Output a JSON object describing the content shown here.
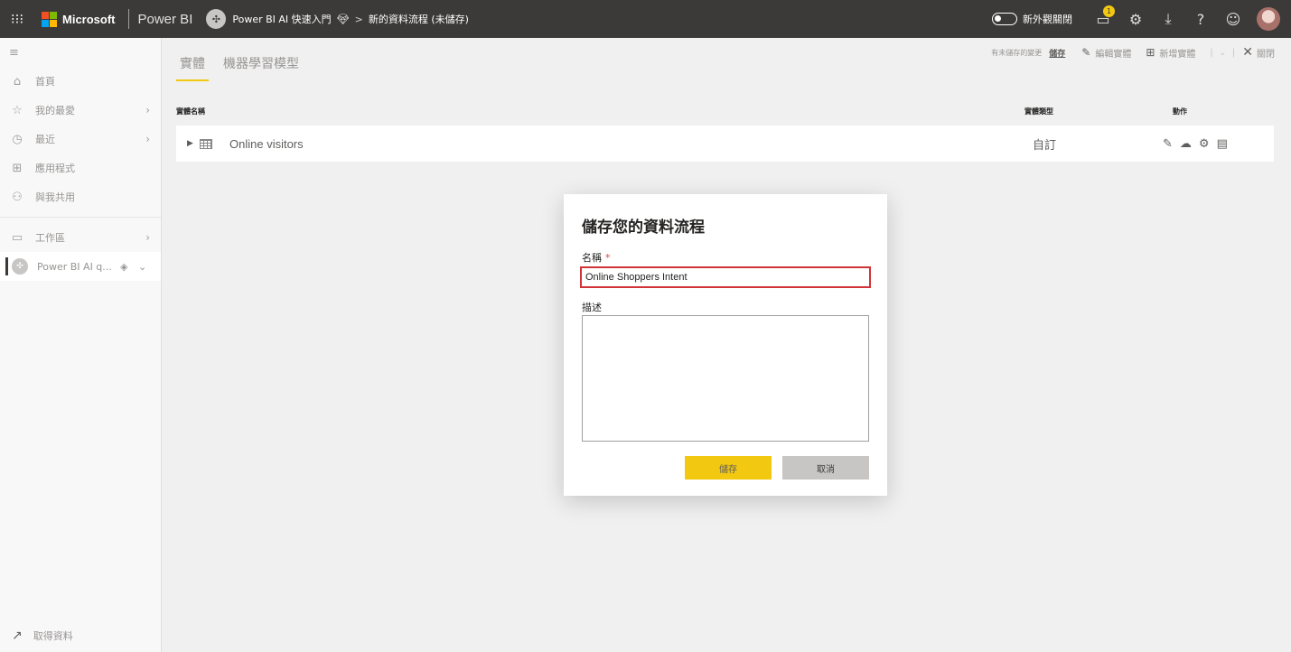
{
  "topbar": {
    "waffle_icon": "⁝⁝⁝",
    "brand": "Microsoft",
    "app_name": "Power BI",
    "workspace": "Power BI AI 快速入門",
    "crumb_sep": ">",
    "page": "新的資料流程 (未儲存)",
    "new_look_label": "新外觀關閉",
    "notification_count": "1",
    "colors": {
      "bar": "#3b3a39",
      "accent": "#f2c811"
    }
  },
  "nav": {
    "items": [
      {
        "label": "首頁",
        "icon": "home-icon"
      },
      {
        "label": "我的最愛",
        "icon": "star-icon"
      },
      {
        "label": "最近",
        "icon": "clock-icon"
      },
      {
        "label": "應用程式",
        "icon": "apps-icon"
      },
      {
        "label": "與我共用",
        "icon": "shared-icon"
      }
    ],
    "workspaces_label": "工作區",
    "current_workspace": "Power BI AI q...",
    "get_data": "取得資料"
  },
  "main": {
    "tabs": [
      {
        "label": "實體",
        "active": true
      },
      {
        "label": "機器學習模型",
        "active": false
      }
    ],
    "unsaved_text": "有未儲存的變更",
    "save_link": "儲存",
    "edit_entity": "編輯實體",
    "add_entity": "新增實體",
    "close": "關閉",
    "columns": {
      "name": "實體名稱",
      "type": "實體類型",
      "actions": "動作"
    },
    "rows": [
      {
        "name": "Online visitors",
        "type": "自訂"
      }
    ]
  },
  "dialog": {
    "title": "儲存您的資料流程",
    "name_label": "名稱",
    "required_mark": "*",
    "name_value": "Online Shoppers Intent",
    "description_label": "描述",
    "description_value": "",
    "save_button": "儲存",
    "cancel_button": "取消"
  }
}
